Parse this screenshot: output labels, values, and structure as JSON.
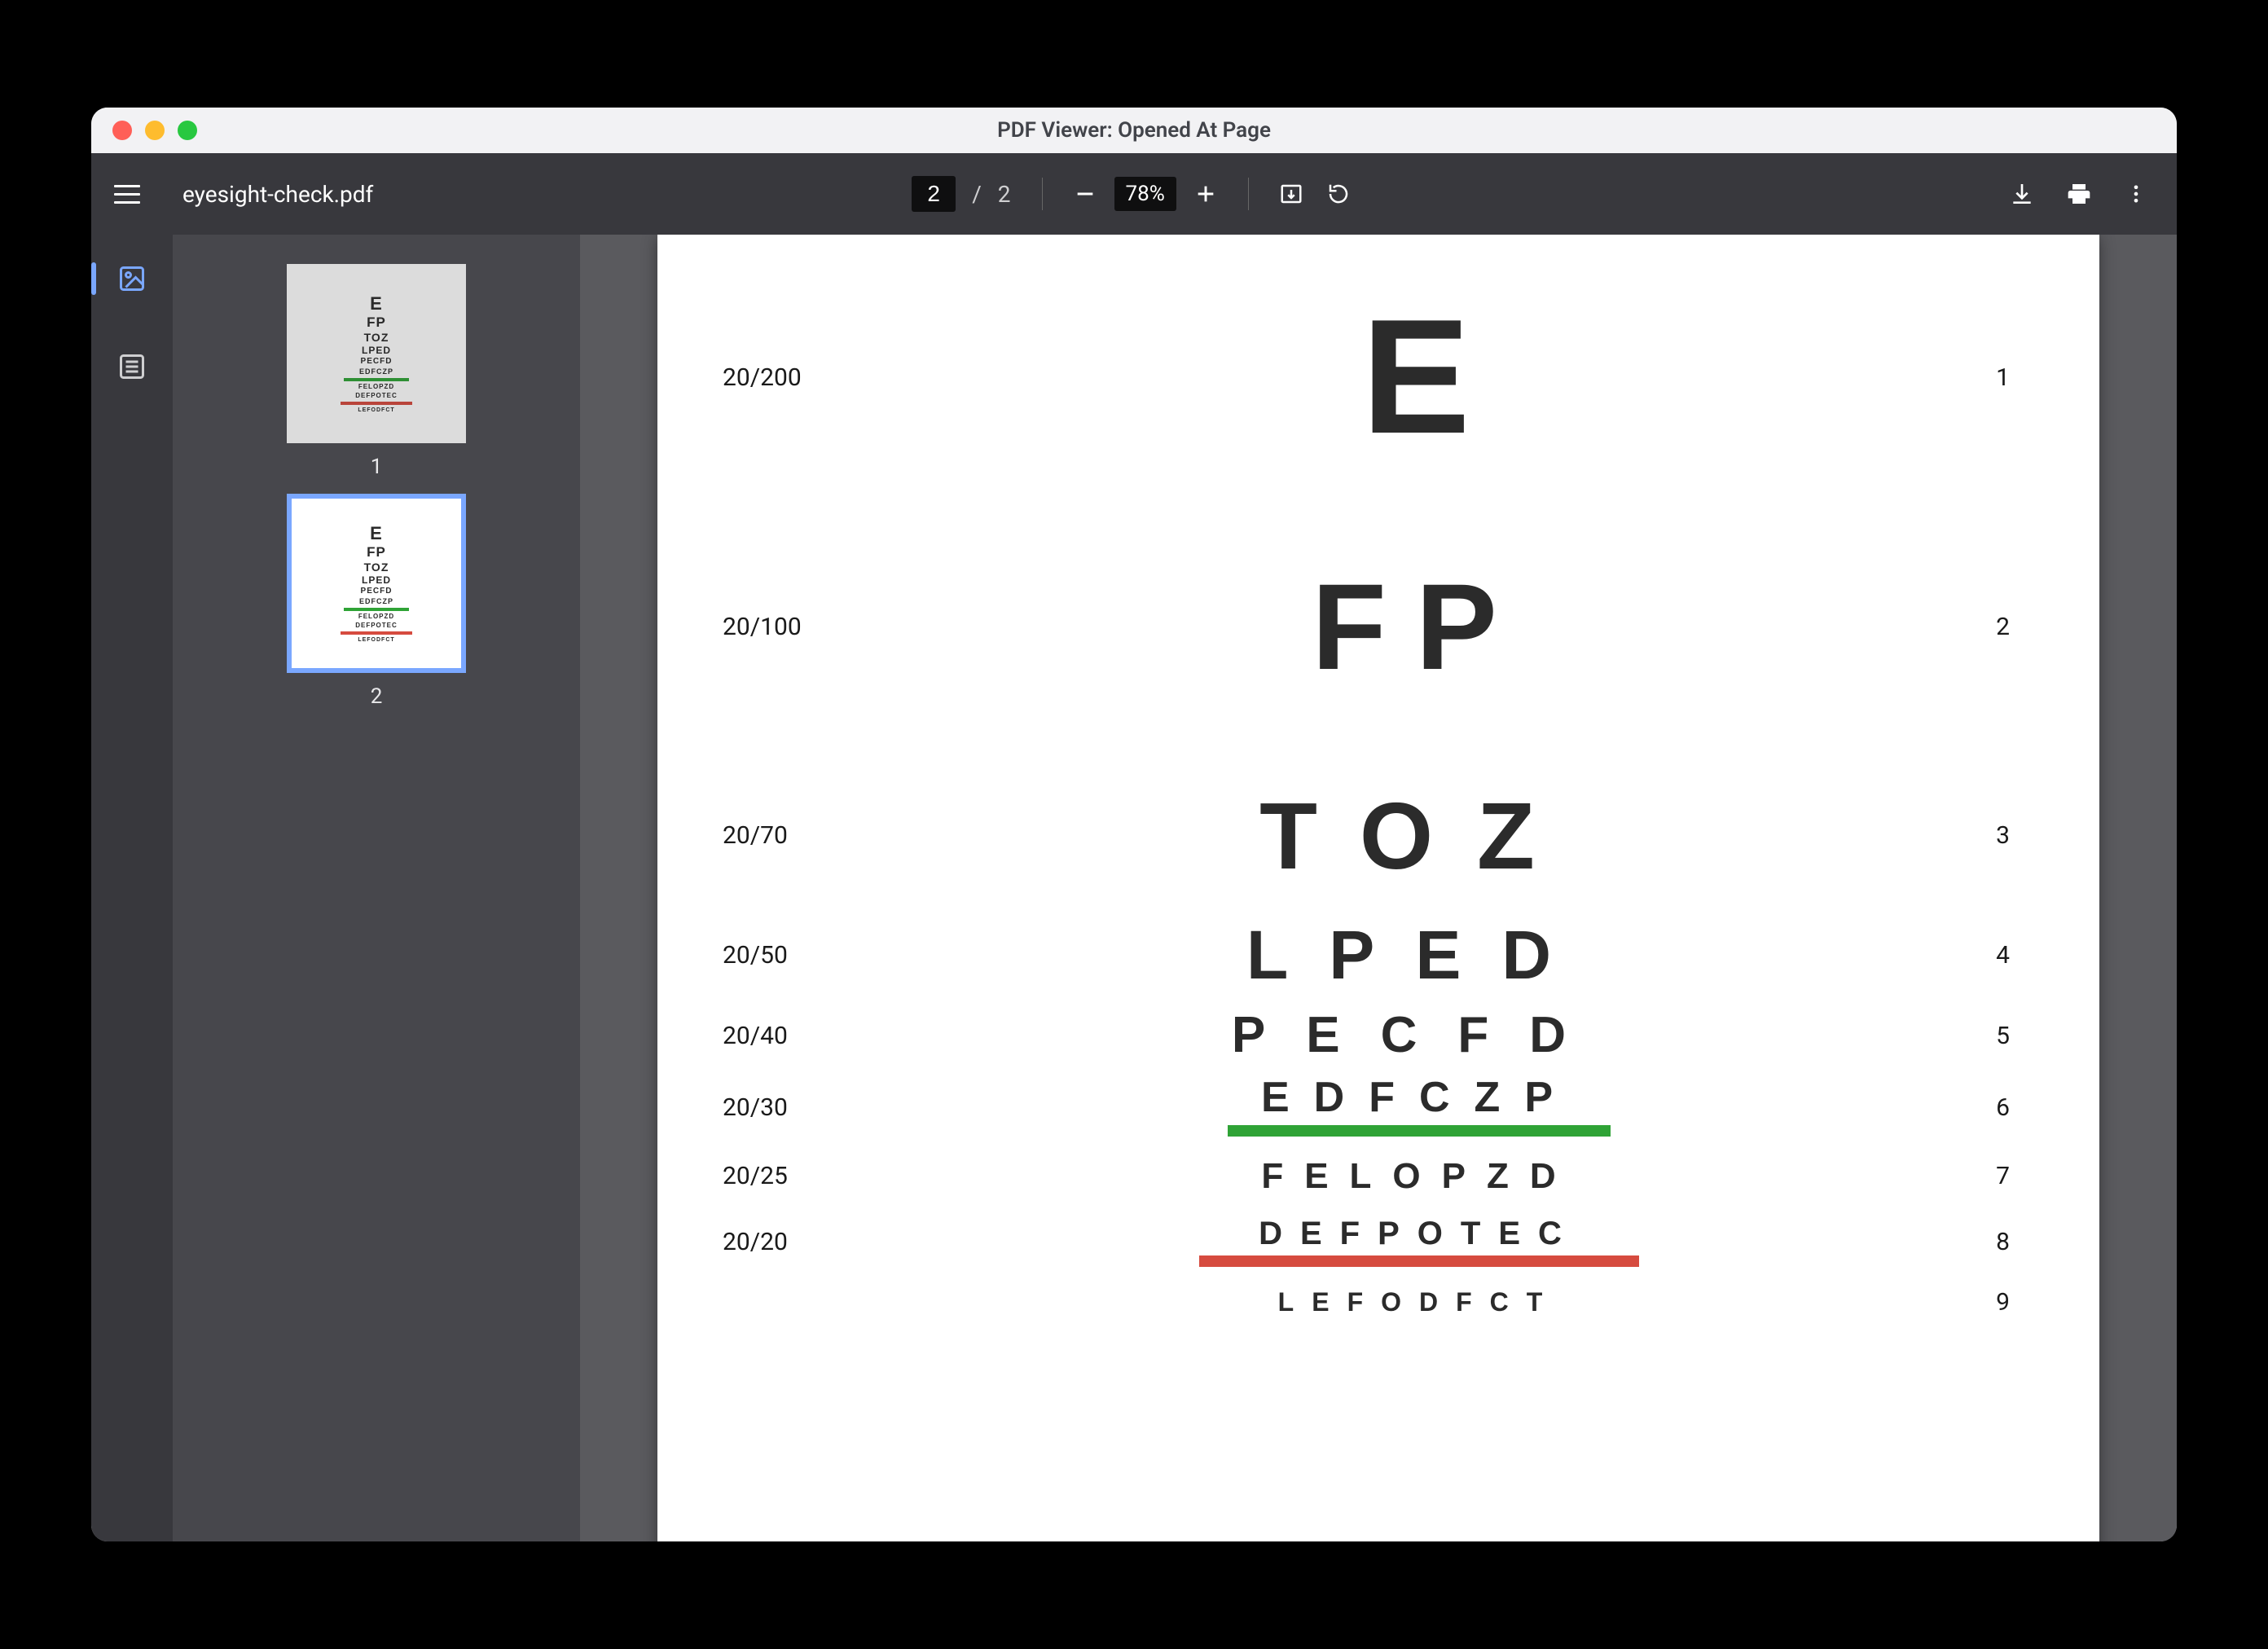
{
  "window": {
    "title": "PDF Viewer: Opened At Page"
  },
  "file": {
    "name": "eyesight-check.pdf"
  },
  "pager": {
    "current": "2",
    "total": "2",
    "sep": "/"
  },
  "zoom": {
    "display": "78%"
  },
  "thumbnails": [
    {
      "label": "1"
    },
    {
      "label": "2"
    }
  ],
  "chart": {
    "rows": [
      {
        "acuity": "20/200",
        "letters": "E",
        "line": "1",
        "size": 200,
        "spacing": 8,
        "gap": 140
      },
      {
        "acuity": "20/100",
        "letters": "FP",
        "line": "2",
        "size": 150,
        "spacing": 36,
        "gap": 130
      },
      {
        "acuity": "20/70",
        "letters": "TOZ",
        "line": "3",
        "size": 116,
        "spacing": 54,
        "gap": 52
      },
      {
        "acuity": "20/50",
        "letters": "LPED",
        "line": "4",
        "size": 84,
        "spacing": 50,
        "gap": 30
      },
      {
        "acuity": "20/40",
        "letters": "PECFD",
        "line": "5",
        "size": 62,
        "spacing": 50,
        "gap": 22
      },
      {
        "acuity": "20/30",
        "letters": "EDFCZP",
        "line": "6",
        "size": 52,
        "spacing": 30,
        "gap": 28,
        "underline": "#2fa336",
        "uwidth": 470
      },
      {
        "acuity": "20/25",
        "letters": "FELOPZD",
        "line": "7",
        "size": 44,
        "spacing": 26,
        "gap": 30
      },
      {
        "acuity": "20/20",
        "letters": "DEFPOTEC",
        "line": "8",
        "size": 40,
        "spacing": 22,
        "gap": 26,
        "underline": "#d64b3f",
        "uwidth": 540
      },
      {
        "acuity": "",
        "letters": "LEFODFCT",
        "line": "9",
        "size": 32,
        "spacing": 22,
        "gap": 18
      }
    ]
  },
  "mini_rows": [
    {
      "t": "E",
      "s": 22
    },
    {
      "t": "FP",
      "s": 17
    },
    {
      "t": "TOZ",
      "s": 14
    },
    {
      "t": "LPED",
      "s": 12
    },
    {
      "t": "PECFD",
      "s": 10
    },
    {
      "t": "EDFCZP",
      "s": 9,
      "g": true
    },
    {
      "t": "FELOPZD",
      "s": 8
    },
    {
      "t": "DEFPOTEC",
      "s": 8,
      "r": true
    },
    {
      "t": "LEFODFCT",
      "s": 7
    }
  ]
}
